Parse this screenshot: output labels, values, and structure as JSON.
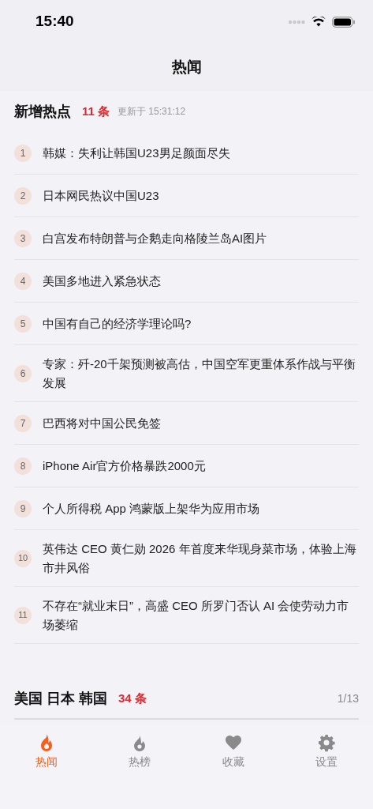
{
  "status_bar": {
    "time": "15:40"
  },
  "nav": {
    "title": "热闻"
  },
  "sections": [
    {
      "title": "新增热点",
      "count": "11 条",
      "updated": "更新于 15:31:12",
      "items": [
        {
          "rank": "1",
          "title": "韩媒：失利让韩国U23男足颜面尽失"
        },
        {
          "rank": "2",
          "title": "日本网民热议中国U23"
        },
        {
          "rank": "3",
          "title": "白宫发布特朗普与企鹅走向格陵兰岛AI图片"
        },
        {
          "rank": "4",
          "title": "美国多地进入紧急状态"
        },
        {
          "rank": "5",
          "title": "中国有自己的经济学理论吗?"
        },
        {
          "rank": "6",
          "title": "专家：歼-20千架预测被高估，中国空军更重体系作战与平衡发展"
        },
        {
          "rank": "7",
          "title": "巴西将对中国公民免签"
        },
        {
          "rank": "8",
          "title": "iPhone Air官方价格暴跌2000元"
        },
        {
          "rank": "9",
          "title": "个人所得税 App 鸿蒙版上架华为应用市场"
        },
        {
          "rank": "10",
          "title": "英伟达 CEO 黄仁勋 2026 年首度来华现身菜市场，体验上海市井风俗"
        },
        {
          "rank": "11",
          "title": "不存在“就业末日”，高盛 CEO 所罗门否认 AI 会使劳动力市场萎缩"
        }
      ]
    },
    {
      "title": "美国 日本 韩国",
      "count": "34 条",
      "page": "1/13"
    }
  ],
  "tabs": [
    {
      "kind": "flame",
      "label": "热闻",
      "selected": true
    },
    {
      "kind": "fire",
      "label": "热榜",
      "selected": false
    },
    {
      "kind": "heart",
      "label": "收藏",
      "selected": false
    },
    {
      "kind": "gear",
      "label": "设置",
      "selected": false
    }
  ]
}
